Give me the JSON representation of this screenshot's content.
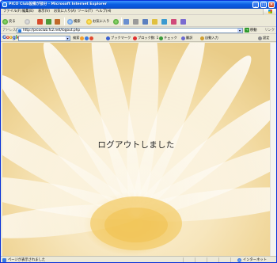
{
  "window": {
    "title": "PICO Club設備が部分 - Microsoft Internet Explorer",
    "min_symbol": "_",
    "max_symbol": "□",
    "close_symbol": "×"
  },
  "menu": {
    "items": [
      "ファイル(F)",
      "編集(E)",
      "表示(V)",
      "お気に入り(A)",
      "ツール(T)",
      "ヘルプ(H)"
    ]
  },
  "toolbar": {
    "back_label": "戻る",
    "search_label": "検索",
    "favorites_label": "お気に入り"
  },
  "address": {
    "label": "アドレス(D)",
    "url": "http://picoclub.fc2.net/logout.php",
    "go_label": "移動",
    "links_label": "リンク"
  },
  "google_bar": {
    "logo": "Google",
    "search_label": "検索",
    "bookmark_label": "ブックマーク",
    "popup_label": "ブロック数: 1",
    "check_label": "チェック",
    "translate_label": "翻訳",
    "autofill_label": "自動入力",
    "settings_label": "設定"
  },
  "content": {
    "message": "ログアウトしました"
  },
  "status": {
    "text": "ページが表示されました",
    "zone": "インターネット"
  },
  "colors": {
    "titlebar": "#0a5fe3",
    "chrome": "#ece9d8",
    "flower_center": "#f4cf76",
    "petal": "#ffffff"
  }
}
